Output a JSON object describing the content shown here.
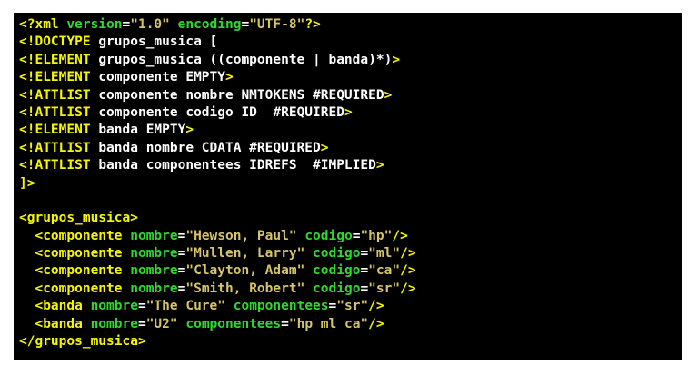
{
  "code_lines": [
    [
      [
        "y",
        "<?xml "
      ],
      [
        "g",
        "version"
      ],
      [
        "w",
        "="
      ],
      [
        "o",
        "\"1.0\""
      ],
      [
        "w",
        " "
      ],
      [
        "g",
        "encoding"
      ],
      [
        "w",
        "="
      ],
      [
        "o",
        "\"UTF-8\""
      ],
      [
        "y",
        "?>"
      ]
    ],
    [
      [
        "y",
        "<!DOCTYPE "
      ],
      [
        "w",
        "grupos_musica ["
      ]
    ],
    [
      [
        "y",
        "<!ELEMENT "
      ],
      [
        "w",
        "grupos_musica ((componente | banda)*)"
      ],
      [
        "y",
        ">"
      ]
    ],
    [
      [
        "y",
        "<!ELEMENT "
      ],
      [
        "w",
        "componente EMPTY"
      ],
      [
        "y",
        ">"
      ]
    ],
    [
      [
        "y",
        "<!ATTLIST "
      ],
      [
        "w",
        "componente nombre NMTOKENS #REQUIRED"
      ],
      [
        "y",
        ">"
      ]
    ],
    [
      [
        "y",
        "<!ATTLIST "
      ],
      [
        "w",
        "componente codigo ID  #REQUIRED"
      ],
      [
        "y",
        ">"
      ]
    ],
    [
      [
        "y",
        "<!ELEMENT "
      ],
      [
        "w",
        "banda EMPTY"
      ],
      [
        "y",
        ">"
      ]
    ],
    [
      [
        "y",
        "<!ATTLIST "
      ],
      [
        "w",
        "banda nombre CDATA #REQUIRED"
      ],
      [
        "y",
        ">"
      ]
    ],
    [
      [
        "y",
        "<!ATTLIST "
      ],
      [
        "w",
        "banda componentees IDREFS  #IMPLIED"
      ],
      [
        "y",
        ">"
      ]
    ],
    [
      [
        "y",
        "]>"
      ]
    ],
    [],
    [
      [
        "y",
        "<grupos_musica>"
      ]
    ],
    [
      [
        "w",
        "  "
      ],
      [
        "y",
        "<componente "
      ],
      [
        "g",
        "nombre"
      ],
      [
        "w",
        "="
      ],
      [
        "o",
        "\"Hewson, Paul\""
      ],
      [
        "w",
        " "
      ],
      [
        "g",
        "codigo"
      ],
      [
        "w",
        "="
      ],
      [
        "o",
        "\"hp\""
      ],
      [
        "y",
        "/>"
      ]
    ],
    [
      [
        "w",
        "  "
      ],
      [
        "y",
        "<componente "
      ],
      [
        "g",
        "nombre"
      ],
      [
        "w",
        "="
      ],
      [
        "o",
        "\"Mullen, Larry\""
      ],
      [
        "w",
        " "
      ],
      [
        "g",
        "codigo"
      ],
      [
        "w",
        "="
      ],
      [
        "o",
        "\"ml\""
      ],
      [
        "y",
        "/>"
      ]
    ],
    [
      [
        "w",
        "  "
      ],
      [
        "y",
        "<componente "
      ],
      [
        "g",
        "nombre"
      ],
      [
        "w",
        "="
      ],
      [
        "o",
        "\"Clayton, Adam\""
      ],
      [
        "w",
        " "
      ],
      [
        "g",
        "codigo"
      ],
      [
        "w",
        "="
      ],
      [
        "o",
        "\"ca\""
      ],
      [
        "y",
        "/>"
      ]
    ],
    [
      [
        "w",
        "  "
      ],
      [
        "y",
        "<componente "
      ],
      [
        "g",
        "nombre"
      ],
      [
        "w",
        "="
      ],
      [
        "o",
        "\"Smith, Robert\""
      ],
      [
        "w",
        " "
      ],
      [
        "g",
        "codigo"
      ],
      [
        "w",
        "="
      ],
      [
        "o",
        "\"sr\""
      ],
      [
        "y",
        "/>"
      ]
    ],
    [
      [
        "w",
        "  "
      ],
      [
        "y",
        "<banda "
      ],
      [
        "g",
        "nombre"
      ],
      [
        "w",
        "="
      ],
      [
        "o",
        "\"The Cure\""
      ],
      [
        "w",
        " "
      ],
      [
        "g",
        "componentees"
      ],
      [
        "w",
        "="
      ],
      [
        "o",
        "\"sr\""
      ],
      [
        "y",
        "/>"
      ]
    ],
    [
      [
        "w",
        "  "
      ],
      [
        "y",
        "<banda "
      ],
      [
        "g",
        "nombre"
      ],
      [
        "w",
        "="
      ],
      [
        "o",
        "\"U2\""
      ],
      [
        "w",
        " "
      ],
      [
        "g",
        "componentees"
      ],
      [
        "w",
        "="
      ],
      [
        "o",
        "\"hp ml ca\""
      ],
      [
        "y",
        "/>"
      ]
    ],
    [
      [
        "y",
        "</grupos_musica>"
      ]
    ]
  ],
  "colors": {
    "background": "#000000",
    "tag": "#f6f600",
    "attribute_name": "#2ed92e",
    "plain_text": "#ffffff",
    "attribute_value": "#d6c46a"
  }
}
